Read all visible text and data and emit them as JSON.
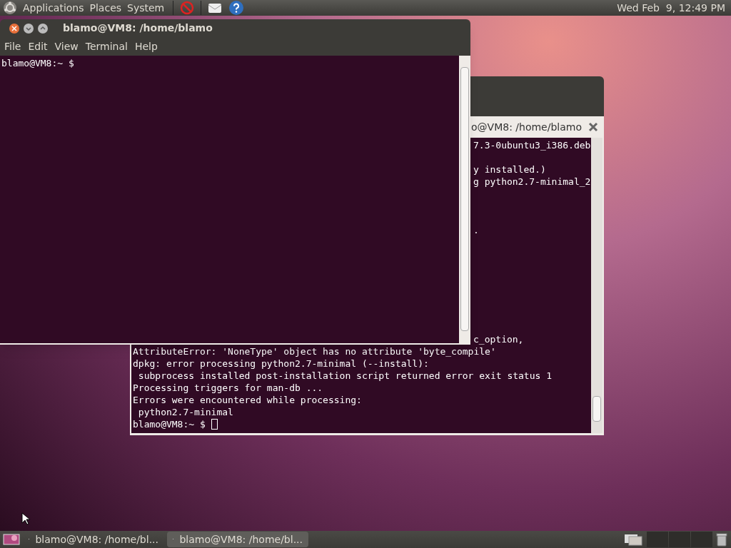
{
  "top_panel": {
    "menus": [
      "Applications",
      "Places",
      "System"
    ],
    "clock": "Wed Feb  9, 12:49 PM"
  },
  "back_terminal": {
    "title": "o@VM8: /home/blamo",
    "lines": [
      {
        "kind": "partial",
        "text": "7.3-0ubuntu3_i386.deb"
      },
      {
        "kind": "blank"
      },
      {
        "kind": "partial",
        "text": "y installed.)"
      },
      {
        "kind": "partial",
        "text": "g python2.7-minimal_2"
      },
      {
        "kind": "blank"
      },
      {
        "kind": "blank"
      },
      {
        "kind": "blank"
      },
      {
        "kind": "partial",
        "text": "."
      },
      {
        "kind": "blank"
      },
      {
        "kind": "blank"
      },
      {
        "kind": "blank"
      },
      {
        "kind": "blank"
      },
      {
        "kind": "blank"
      },
      {
        "kind": "blank"
      },
      {
        "kind": "blank"
      },
      {
        "kind": "blank"
      },
      {
        "kind": "partial",
        "text": "c_option,"
      },
      {
        "kind": "full",
        "text": "AttributeError: 'NoneType' object has no attribute 'byte_compile'"
      },
      {
        "kind": "full",
        "text": "dpkg: error processing python2.7-minimal (--install):"
      },
      {
        "kind": "full",
        "text": " subprocess installed post-installation script returned error exit status 1"
      },
      {
        "kind": "full",
        "text": "Processing triggers for man-db ..."
      },
      {
        "kind": "full",
        "text": "Errors were encountered while processing:"
      },
      {
        "kind": "full",
        "text": " python2.7-minimal"
      },
      {
        "kind": "prompt",
        "text": "blamo@VM8:~ $ "
      }
    ]
  },
  "front_terminal": {
    "title": "blamo@VM8: /home/blamo",
    "menus": [
      "File",
      "Edit",
      "View",
      "Terminal",
      "Help"
    ],
    "lines": [
      {
        "kind": "full",
        "text": "blamo@VM8:~ $"
      }
    ]
  },
  "taskbar": {
    "items": [
      {
        "label": "blamo@VM8: /home/bl...",
        "selected": false
      },
      {
        "label": "blamo@VM8: /home/bl...",
        "selected": true
      }
    ]
  }
}
